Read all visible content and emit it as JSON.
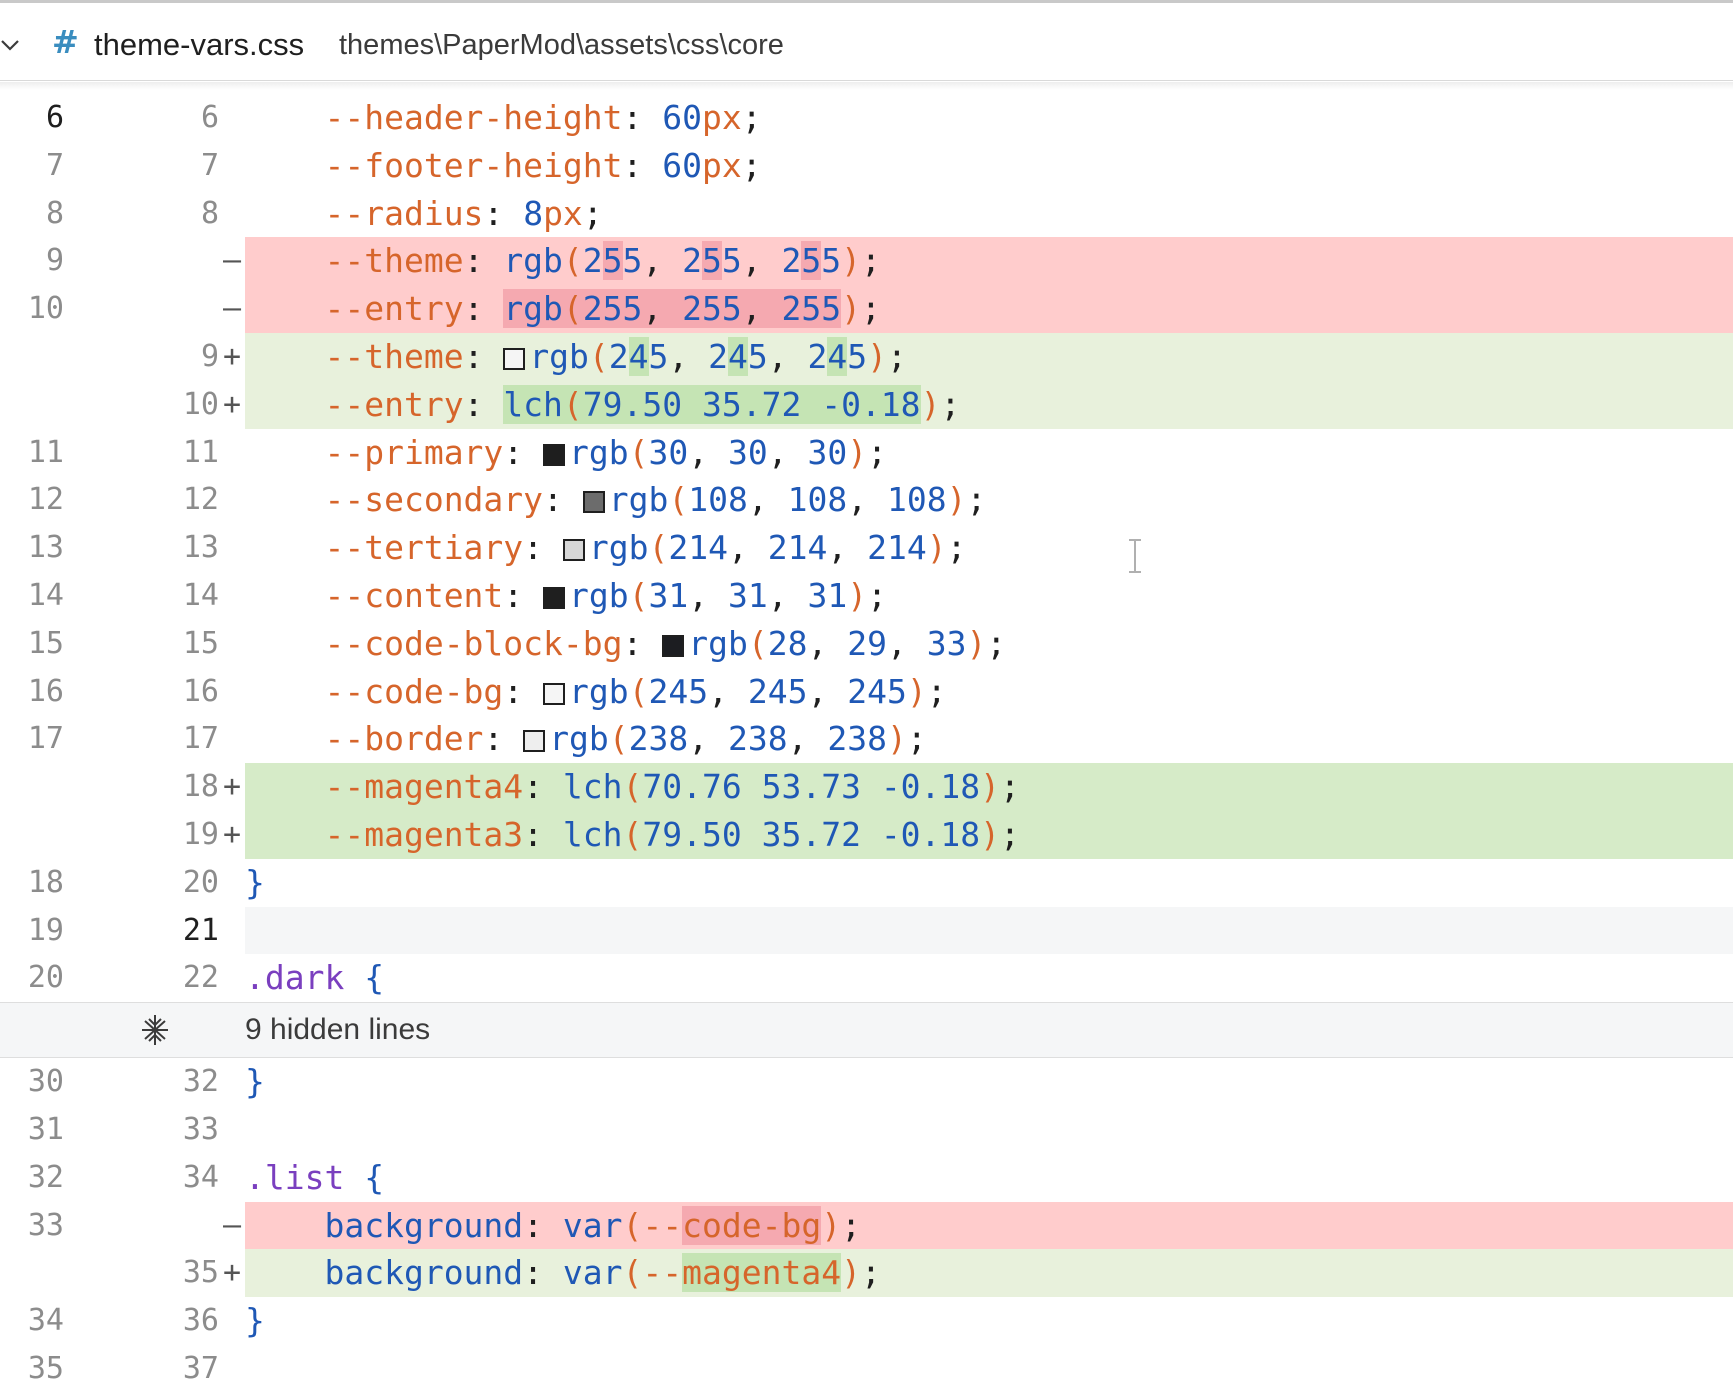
{
  "file": {
    "icon": "hash-icon",
    "name": "theme-vars.css",
    "path": "themes\\PaperMod\\assets\\css\\core"
  },
  "rows": [
    {
      "old": "6",
      "new": "6",
      "type": "ctx",
      "code": "    --header-height: 60px;"
    },
    {
      "old": "7",
      "new": "7",
      "type": "ctx",
      "code": "    --footer-height: 60px;"
    },
    {
      "old": "8",
      "new": "8",
      "type": "ctx",
      "code": "    --radius: 8px;"
    },
    {
      "old": "9",
      "new": "",
      "type": "del",
      "code": "    --theme: rgb(255, 255, 255);"
    },
    {
      "old": "10",
      "new": "",
      "type": "del",
      "code": "    --entry: rgb(255, 255, 255);"
    },
    {
      "old": "",
      "new": "9",
      "type": "ins",
      "code": "    --theme: rgb(245, 245, 245);"
    },
    {
      "old": "",
      "new": "10",
      "type": "ins",
      "code": "    --entry: lch(79.50 35.72 -0.18);"
    },
    {
      "old": "11",
      "new": "11",
      "type": "ctx",
      "code": "    --primary: rgb(30, 30, 30);"
    },
    {
      "old": "12",
      "new": "12",
      "type": "ctx",
      "code": "    --secondary: rgb(108, 108, 108);"
    },
    {
      "old": "13",
      "new": "13",
      "type": "ctx",
      "code": "    --tertiary: rgb(214, 214, 214);"
    },
    {
      "old": "14",
      "new": "14",
      "type": "ctx",
      "code": "    --content: rgb(31, 31, 31);"
    },
    {
      "old": "15",
      "new": "15",
      "type": "ctx",
      "code": "    --code-block-bg: rgb(28, 29, 33);"
    },
    {
      "old": "16",
      "new": "16",
      "type": "ctx",
      "code": "    --code-bg: rgb(245, 245, 245);"
    },
    {
      "old": "17",
      "new": "17",
      "type": "ctx",
      "code": "    --border: rgb(238, 238, 238);"
    },
    {
      "old": "",
      "new": "18",
      "type": "ins",
      "code": "    --magenta4: lch(70.76 53.73 -0.18);"
    },
    {
      "old": "",
      "new": "19",
      "type": "ins",
      "code": "    --magenta3: lch(79.50 35.72 -0.18);"
    },
    {
      "old": "18",
      "new": "20",
      "type": "ctx",
      "code": "}"
    },
    {
      "old": "19",
      "new": "21",
      "type": "cur",
      "code": ""
    },
    {
      "old": "20",
      "new": "22",
      "type": "ctx",
      "code": ".dark {"
    },
    {
      "old": "30",
      "new": "32",
      "type": "ctx",
      "code": "}"
    },
    {
      "old": "31",
      "new": "33",
      "type": "ctx",
      "code": ""
    },
    {
      "old": "32",
      "new": "34",
      "type": "ctx",
      "code": ".list {"
    },
    {
      "old": "33",
      "new": "",
      "type": "del",
      "code": "    background: var(--code-bg);"
    },
    {
      "old": "",
      "new": "35",
      "type": "ins",
      "code": "    background: var(--magenta4);"
    },
    {
      "old": "34",
      "new": "36",
      "type": "ctx",
      "code": "}"
    },
    {
      "old": "35",
      "new": "37",
      "type": "ctx",
      "code": ""
    }
  ],
  "hidden": {
    "label": "9 hidden lines",
    "icon": "unfold-icon"
  },
  "signs": {
    "del": "—",
    "ins": "+"
  },
  "colors": {
    "deleted_bg": "#ffcccc",
    "inserted_bg": "#e8f1dc",
    "keyword": "#d6652b",
    "number": "#1f58b5",
    "hash_icon": "#3a8dbf"
  }
}
